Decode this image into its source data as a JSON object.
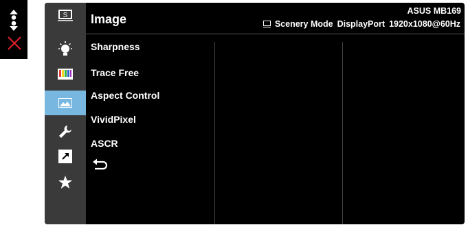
{
  "controls": {
    "nav_icon": "up-down-navigate-icon",
    "close_icon": "close-icon",
    "close_color": "#e0202a"
  },
  "osd": {
    "title": "Image",
    "model": "ASUS MB169",
    "status": {
      "mode": "Scenery Mode",
      "input": "DisplayPort",
      "resolution": "1920x1080@60Hz"
    },
    "sidebar": [
      {
        "icon": "splendid-s-icon",
        "active": false
      },
      {
        "icon": "brightness-bulb-icon",
        "active": false
      },
      {
        "icon": "color-bars-icon",
        "active": false
      },
      {
        "icon": "image-landscape-icon",
        "active": true
      },
      {
        "icon": "wrench-icon",
        "active": false
      },
      {
        "icon": "shortcut-arrow-icon",
        "active": false
      },
      {
        "icon": "star-icon",
        "active": false
      }
    ],
    "menu": [
      "Sharpness",
      "Trace Free",
      "Aspect Control",
      "VividPixel",
      "ASCR"
    ],
    "back_icon": "return-arrow-icon",
    "accent": "#78b7e0"
  }
}
